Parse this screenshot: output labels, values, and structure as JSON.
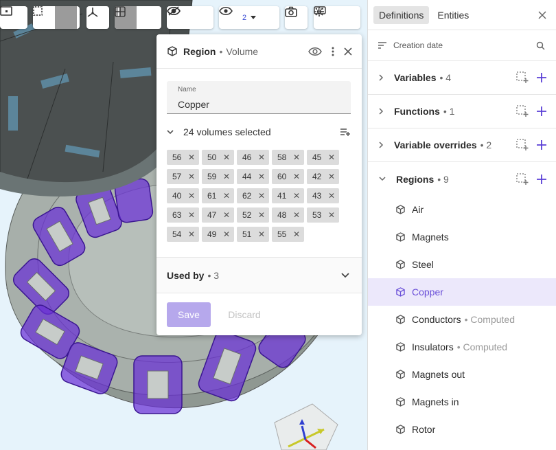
{
  "toolbar": {
    "visibility_count": "2"
  },
  "region_panel": {
    "title": "Region",
    "separator": "•",
    "type": "Volume",
    "name_label": "Name",
    "name_value": "Copper",
    "selection_text": "24 volumes selected",
    "volumes": [
      "56",
      "50",
      "46",
      "58",
      "45",
      "57",
      "59",
      "44",
      "60",
      "42",
      "40",
      "61",
      "62",
      "41",
      "43",
      "63",
      "47",
      "52",
      "48",
      "53",
      "54",
      "49",
      "51",
      "55"
    ],
    "remove_glyph": "✕",
    "used_by_label": "Used by",
    "used_by_count": "• 3",
    "save_label": "Save",
    "discard_label": "Discard"
  },
  "right_panel": {
    "tabs": [
      "Definitions",
      "Entities"
    ],
    "sort_label": "Creation date",
    "sections": [
      {
        "label": "Variables",
        "count": "• 4"
      },
      {
        "label": "Functions",
        "count": "• 1"
      },
      {
        "label": "Variable overrides",
        "count": "• 2"
      },
      {
        "label": "Regions",
        "count": "• 9"
      }
    ],
    "regions": [
      {
        "label": "Air",
        "sub": ""
      },
      {
        "label": "Magnets",
        "sub": ""
      },
      {
        "label": "Steel",
        "sub": ""
      },
      {
        "label": "Copper",
        "sub": ""
      },
      {
        "label": "Conductors",
        "sub": "• Computed"
      },
      {
        "label": "Insulators",
        "sub": "• Computed"
      },
      {
        "label": "Magnets out",
        "sub": ""
      },
      {
        "label": "Magnets in",
        "sub": ""
      },
      {
        "label": "Rotor",
        "sub": ""
      }
    ]
  },
  "colors": {
    "accent": "#6a4fd8",
    "save_bg": "#b6a8ec",
    "coil": "#6a2fd6",
    "stator": "#8f9892",
    "viewport_bg": "#e6f3fb"
  },
  "icons": [
    "box-select-icon",
    "square-icon",
    "dotted-square-icon",
    "axes-icon",
    "layout-split-icon",
    "grid-icon",
    "eye-slash-icon",
    "eye-off-icon",
    "eye-refresh-icon",
    "camera-icon",
    "keyboard-icon",
    "gear-icon",
    "cube-icon",
    "eye-icon",
    "kebab-icon",
    "close-icon",
    "chevron-down-icon",
    "list-add-icon",
    "sort-icon",
    "search-icon",
    "chevron-right-icon",
    "select-add-icon",
    "plus-icon"
  ]
}
